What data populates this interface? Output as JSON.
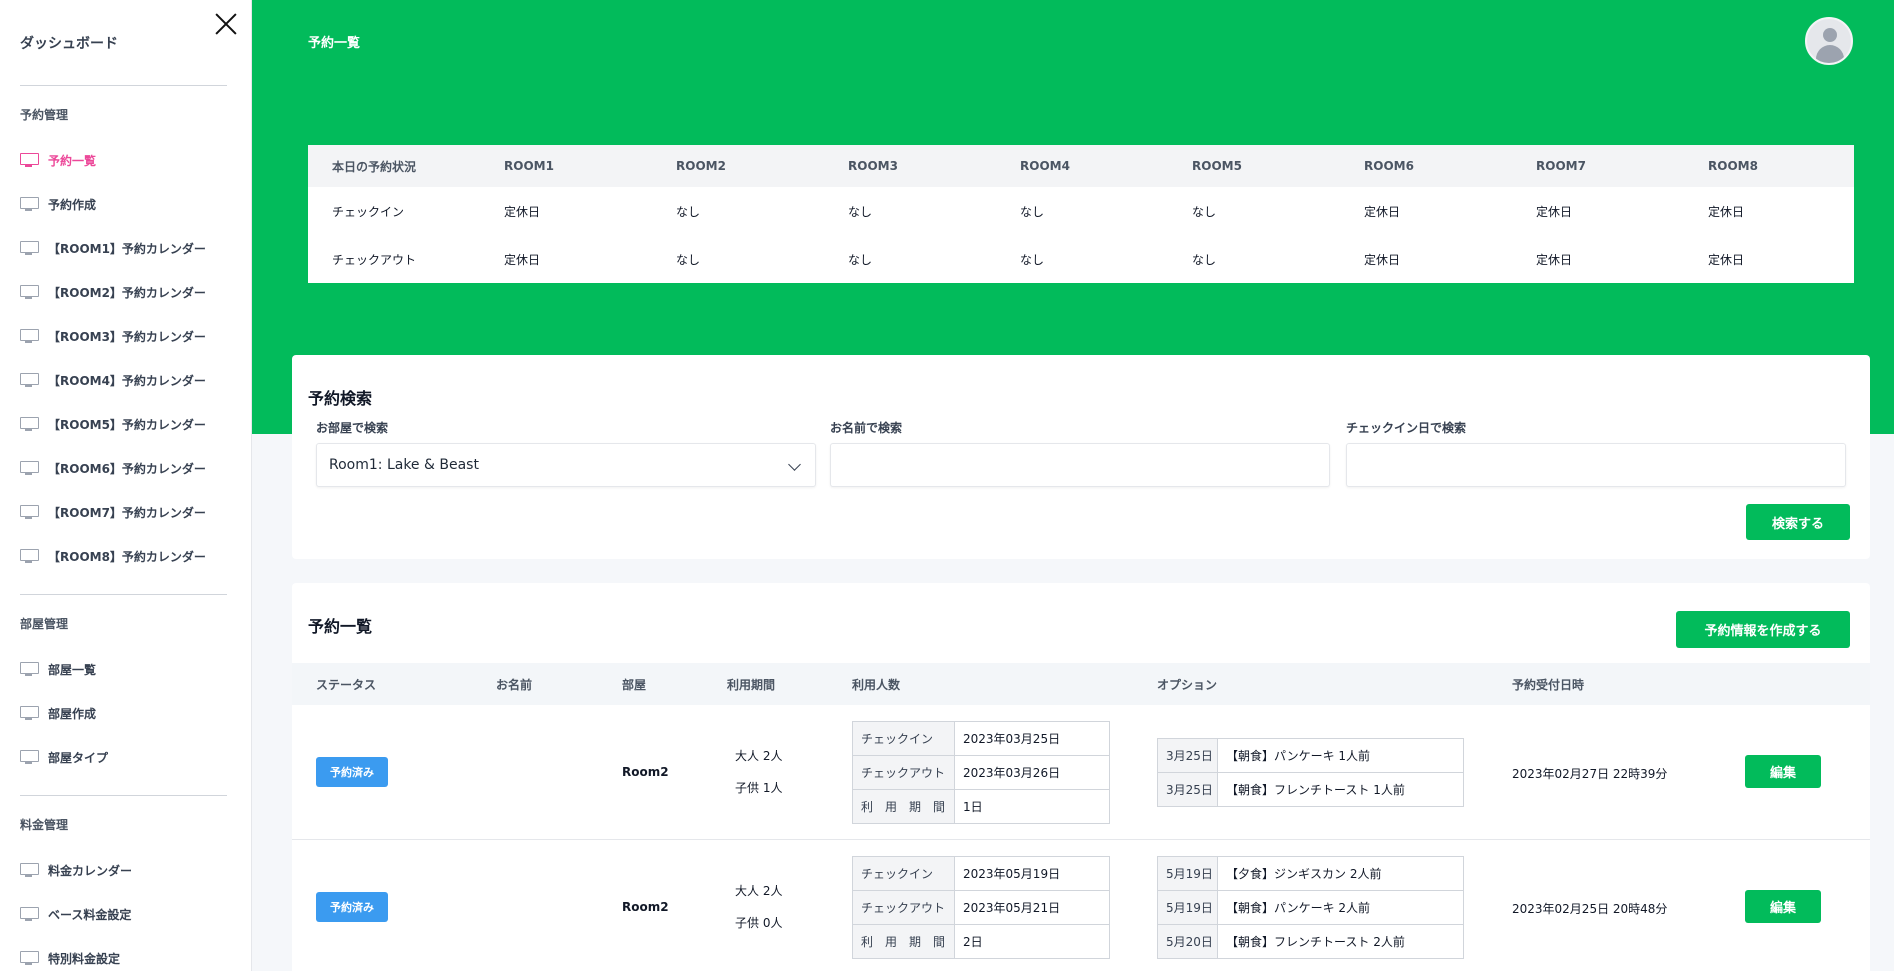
{
  "sidebar": {
    "brand": "ダッシュボード",
    "sections": [
      {
        "title": "予約管理",
        "items": [
          "予約一覧",
          "予約作成",
          "【ROOM1】予約カレンダー",
          "【ROOM2】予約カレンダー",
          "【ROOM3】予約カレンダー",
          "【ROOM4】予約カレンダー",
          "【ROOM5】予約カレンダー",
          "【ROOM6】予約カレンダー",
          "【ROOM7】予約カレンダー",
          "【ROOM8】予約カレンダー"
        ]
      },
      {
        "title": "部屋管理",
        "items": [
          "部屋一覧",
          "部屋作成",
          "部屋タイプ"
        ]
      },
      {
        "title": "料金管理",
        "items": [
          "料金カレンダー",
          "ベース料金設定",
          "特別料金設定"
        ]
      }
    ],
    "active_item": "予約一覧",
    "active_color": "#ec4899"
  },
  "header": {
    "title": "予約一覧",
    "color": "#02bb5b"
  },
  "today_table": {
    "headers": [
      "本日の予約状況",
      "ROOM1",
      "ROOM2",
      "ROOM3",
      "ROOM4",
      "ROOM5",
      "ROOM6",
      "ROOM7",
      "ROOM8"
    ],
    "rows": [
      [
        "チェックイン",
        "定休日",
        "なし",
        "なし",
        "なし",
        "なし",
        "定休日",
        "定休日",
        "定休日"
      ],
      [
        "チェックアウト",
        "定休日",
        "なし",
        "なし",
        "なし",
        "なし",
        "定休日",
        "定休日",
        "定休日"
      ]
    ]
  },
  "search": {
    "title": "予約検索",
    "room_label": "お部屋で検索",
    "room_value": "Room1: Lake & Beast",
    "name_label": "お名前で検索",
    "name_value": "",
    "checkin_label": "チェックイン日で検索",
    "checkin_value": "",
    "submit": "検索する"
  },
  "list": {
    "title": "予約一覧",
    "create_button": "予約情報を作成する",
    "columns": [
      "ステータス",
      "お名前",
      "部屋",
      "利用期間",
      "利用人数",
      "オプション",
      "予約受付日時"
    ],
    "rows": [
      {
        "status": "予約済み",
        "name": "",
        "room": "Room2",
        "adults": "大人  2人",
        "children": "子供  1人",
        "stay": [
          [
            "チェックイン",
            "2023年03月25日"
          ],
          [
            "チェックアウト",
            "2023年03月26日"
          ],
          [
            "利　用　期　間",
            "1日"
          ]
        ],
        "options": [
          [
            "3月25日",
            "【朝食】パンケーキ 1人前"
          ],
          [
            "3月25日",
            "【朝食】フレンチトースト 1人前"
          ]
        ],
        "received": "2023年02月27日 22時39分",
        "edit": "編集"
      },
      {
        "status": "予約済み",
        "name": "",
        "room": "Room2",
        "adults": "大人  2人",
        "children": "子供  0人",
        "stay": [
          [
            "チェックイン",
            "2023年05月19日"
          ],
          [
            "チェックアウト",
            "2023年05月21日"
          ],
          [
            "利　用　期　間",
            "2日"
          ]
        ],
        "options": [
          [
            "5月19日",
            "【夕食】ジンギスカン 2人前"
          ],
          [
            "5月19日",
            "【朝食】パンケーキ 2人前"
          ],
          [
            "5月20日",
            "【朝食】フレンチトースト 2人前"
          ]
        ],
        "received": "2023年02月25日 20時48分",
        "edit": "編集"
      }
    ]
  }
}
